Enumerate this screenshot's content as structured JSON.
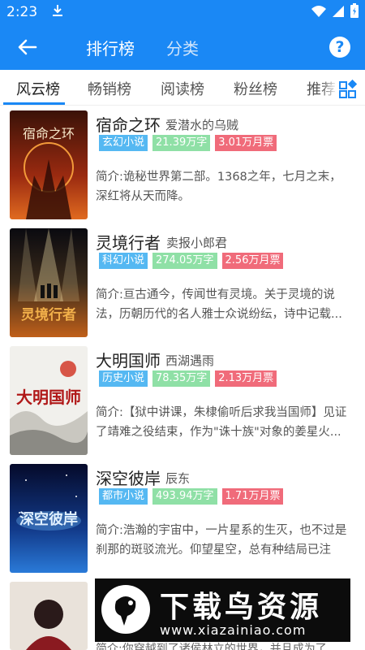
{
  "status_bar": {
    "time": "2:23"
  },
  "app_bar": {
    "tab_main": "排行榜",
    "tab_sub": "分类"
  },
  "sub_tabs": [
    "风云榜",
    "畅销榜",
    "阅读榜",
    "粉丝榜",
    "推荐"
  ],
  "books": [
    {
      "title": "宿命之环",
      "author": "爱潜水的乌贼",
      "genre": "玄幻小说",
      "words": "21.39万字",
      "tickets": "3.01万月票",
      "desc": "简介:诡秘世界第二部。1368之年，七月之末，深红将从天而降。",
      "cover_title": "宿命之环"
    },
    {
      "title": "灵境行者",
      "author": "卖报小郎君",
      "genre": "科幻小说",
      "words": "274.05万字",
      "tickets": "2.56万月票",
      "desc": "简介:亘古通今，传闻世有灵境。关于灵境的说法，历朝历代的名人雅士众说纷纭，诗中记载...",
      "cover_title": "灵境行者"
    },
    {
      "title": "大明国师",
      "author": "西湖遇雨",
      "genre": "历史小说",
      "words": "78.35万字",
      "tickets": "2.13万月票",
      "desc": "简介:【狱中讲课，朱棣偷听后求我当国师】见证了靖难之役结束，作为\"诛十族\"对象的姜星火...",
      "cover_title": "大明国师"
    },
    {
      "title": "深空彼岸",
      "author": "辰东",
      "genre": "都市小说",
      "words": "493.94万字",
      "tickets": "1.71万月票",
      "desc": "简介:浩瀚的宇宙中，一片星系的生灭，也不过是刹那的斑驳流光。仰望星空，总有种结局已注定...",
      "cover_title": "深空彼岸"
    }
  ],
  "peek_desc": "简介:你穿越到了诸侯林立的世界，并且成为了",
  "watermark": {
    "text": "下载鸟资源",
    "url": "www.xiazainiao.com"
  },
  "colors": {
    "primary": "#1a88f5",
    "genre_tag": "#55b8f2",
    "words_tag": "#8fe0a6",
    "tickets_tag": "#f06b7a"
  }
}
